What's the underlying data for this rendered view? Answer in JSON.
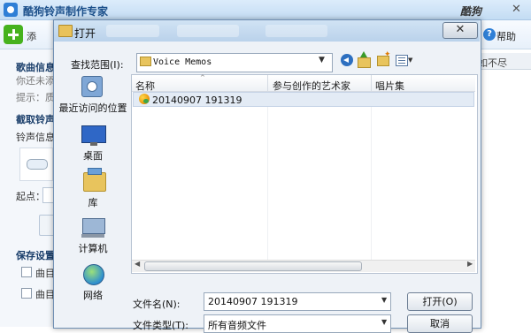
{
  "app": {
    "title": "酷狗铃声制作专家",
    "brand": "酷狗",
    "close_glyph": "✕",
    "toolbar": {
      "add_label": "添",
      "help_label": "帮助",
      "help_glyph": "?"
    },
    "left_panel": {
      "song_info_heading": "歌曲信息",
      "song_info_text": "你还未添",
      "hint": "提示：质",
      "clip_heading": "截取铃声",
      "ringtone_info": "铃声信息",
      "start_label": "起点：",
      "save_heading": "保存设置",
      "check1_label": "曲目",
      "check2_label": "曲目"
    },
    "right_strip": {
      "column_header": "如不尽"
    }
  },
  "dialog": {
    "title": "打开",
    "close_glyph": "✕",
    "look_in_label": "查找范围(I):",
    "look_in_value": "Voice Memos",
    "places": [
      {
        "label": "最近访问的位置"
      },
      {
        "label": "桌面"
      },
      {
        "label": "库"
      },
      {
        "label": "计算机"
      },
      {
        "label": "网络"
      }
    ],
    "columns": [
      "名称",
      "参与创作的艺术家",
      "唱片集"
    ],
    "sort_glyph": "^",
    "files": [
      {
        "name": "20140907 191319",
        "selected": true
      }
    ],
    "file_name_label": "文件名(N):",
    "file_name_value": "20140907 191319",
    "file_type_label": "文件类型(T):",
    "file_type_value": "所有音频文件",
    "open_button": "打开(O)",
    "cancel_button": "取消",
    "dropdown_glyph": "▼",
    "scroll_left_glyph": "◀",
    "scroll_right_glyph": "▶"
  }
}
